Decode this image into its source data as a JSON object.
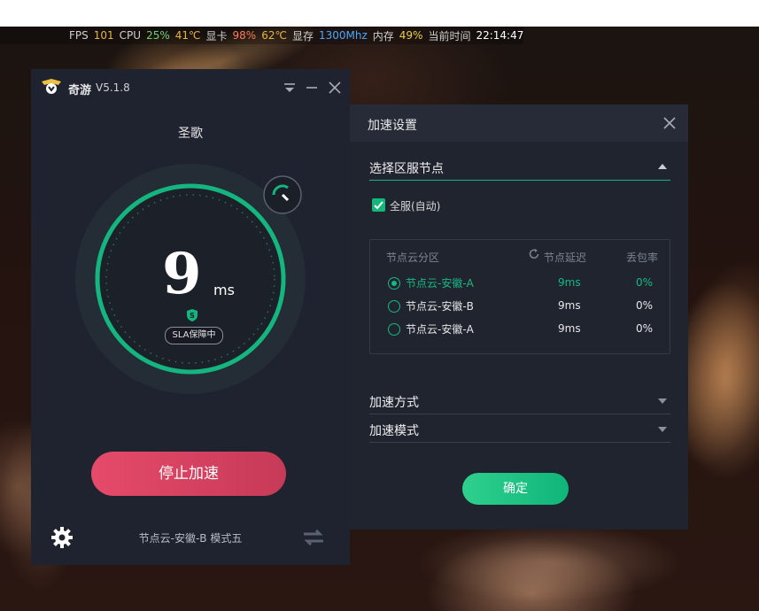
{
  "overlay": {
    "fps_label": "FPS",
    "fps_value": "101",
    "cpu_label": "CPU",
    "cpu_value": "25%",
    "cpu_temp": "41℃",
    "gpu_label": "显卡",
    "gpu_value": "98%",
    "gpu_temp": "62℃",
    "vram_label": "显存",
    "vram_value": "1300Mhz",
    "mem_label": "内存",
    "mem_value": "49%",
    "time_label": "当前时间",
    "time_value": "22:14:47",
    "colors": {
      "fps": "#e8b440",
      "cpu": "#6fd36f",
      "temp": "#e8b440",
      "gpu": "#ff7a59",
      "vram": "#4aa8ff",
      "mem": "#e8d040"
    }
  },
  "app": {
    "name": "奇游",
    "version": "V5.1.8",
    "game": "圣歌",
    "latency_value": "9",
    "latency_unit": "ms",
    "sla_badge": "SLA保障中",
    "stop_label": "停止加速",
    "footer_status": "节点云-安徽-B 模式五",
    "accent": "#16b983"
  },
  "panel": {
    "title": "加速设置",
    "region_label": "选择区服节点",
    "auto_checkbox_label": "全服(自动)",
    "auto_checked": true,
    "table_headers": {
      "zone": "节点云分区",
      "delay": "节点延迟",
      "loss": "丢包率"
    },
    "rows": [
      {
        "name": "节点云-安徽-A",
        "delay": "9ms",
        "loss": "0%",
        "selected": true
      },
      {
        "name": "节点云-安徽-B",
        "delay": "9ms",
        "loss": "0%",
        "selected": false
      },
      {
        "name": "节点云-安徽-A",
        "delay": "9ms",
        "loss": "0%",
        "selected": false
      }
    ],
    "method_label": "加速方式",
    "mode_label": "加速模式",
    "confirm_label": "确定"
  }
}
